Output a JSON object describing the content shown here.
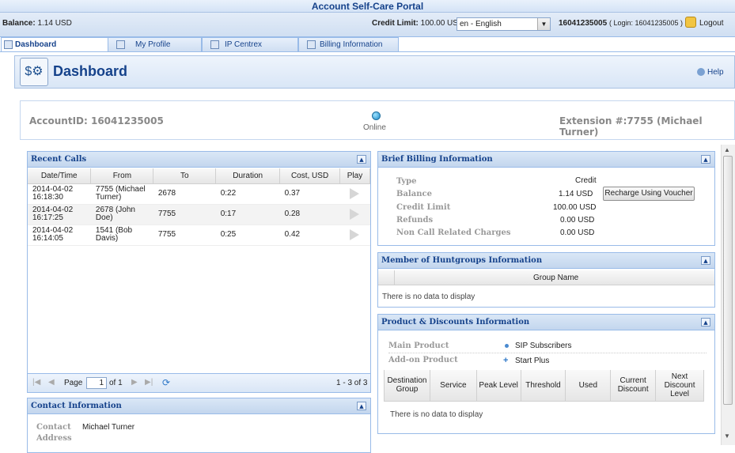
{
  "app": {
    "title": "Account Self-Care Portal"
  },
  "infobar": {
    "balance_label": "Balance:",
    "balance": "1.14 USD",
    "credit_limit_label": "Credit Limit:",
    "credit_limit": "100.00 USD",
    "language": "en - English",
    "account_number": "16041235005",
    "login_text": "( Login: 16041235005 )",
    "logout": "Logout"
  },
  "tabs": [
    {
      "label": "Dashboard",
      "icon": "dashboard-icon"
    },
    {
      "label": "My Profile",
      "icon": "profile-icon"
    },
    {
      "label": "IP Centrex",
      "icon": "ip-centrex-icon"
    },
    {
      "label": "Billing Information",
      "icon": "billing-icon"
    }
  ],
  "header": {
    "title": "Dashboard",
    "help": "Help"
  },
  "account": {
    "account_id": "AccountID: 16041235005",
    "status": "Online",
    "extension": "Extension #:7755 (Michael Turner)"
  },
  "recent_calls": {
    "title": "Recent Calls",
    "columns": [
      "Date/Time",
      "From",
      "To",
      "Duration",
      "Cost, USD",
      "Play"
    ],
    "rows": [
      {
        "date": "2014-04-02",
        "time": "16:18:30",
        "from1": "7755 (Michael",
        "from2": "Turner)",
        "to": "2678",
        "duration": "0:22",
        "cost": "0.37"
      },
      {
        "date": "2014-04-02",
        "time": "16:17:25",
        "from1": "2678 (John Doe)",
        "from2": "",
        "to": "7755",
        "duration": "0:17",
        "cost": "0.28"
      },
      {
        "date": "2014-04-02",
        "time": "16:14:05",
        "from1": "1541 (Bob",
        "from2": "Davis)",
        "to": "7755",
        "duration": "0:25",
        "cost": "0.42"
      }
    ],
    "pager": {
      "page_label": "Page",
      "page_value": "1",
      "of_label": "of 1",
      "summary": "1 - 3 of 3"
    }
  },
  "contact": {
    "title": "Contact Information",
    "contact_label": "Contact",
    "contact_value": "Michael Turner",
    "address_label": "Address"
  },
  "billing": {
    "title": "Brief Billing Information",
    "type_label": "Type",
    "type_value": "Credit",
    "balance_label": "Balance",
    "balance_value": "1.14 USD",
    "recharge_button": "Recharge Using Voucher",
    "credit_limit_label": "Credit Limit",
    "credit_limit_value": "100.00 USD",
    "refunds_label": "Refunds",
    "refunds_value": "0.00 USD",
    "ncrc_label": "Non Call Related Charges",
    "ncrc_value": "0.00 USD"
  },
  "huntgroups": {
    "title": "Member of Huntgroups Information",
    "column": "Group Name",
    "empty": "There is no data to display"
  },
  "products": {
    "title": "Product & Discounts Information",
    "main_label": "Main Product",
    "main_value": "SIP Subscribers",
    "addon_label": "Add-on Product",
    "addon_value": "Start Plus",
    "columns": [
      "Destination Group",
      "Service",
      "Peak Level",
      "Threshold",
      "Used",
      "Current Discount",
      "Next Discount Level"
    ],
    "empty": "There is no data to display"
  },
  "colors": {
    "accent": "#15428b",
    "border": "#99bbe8"
  }
}
